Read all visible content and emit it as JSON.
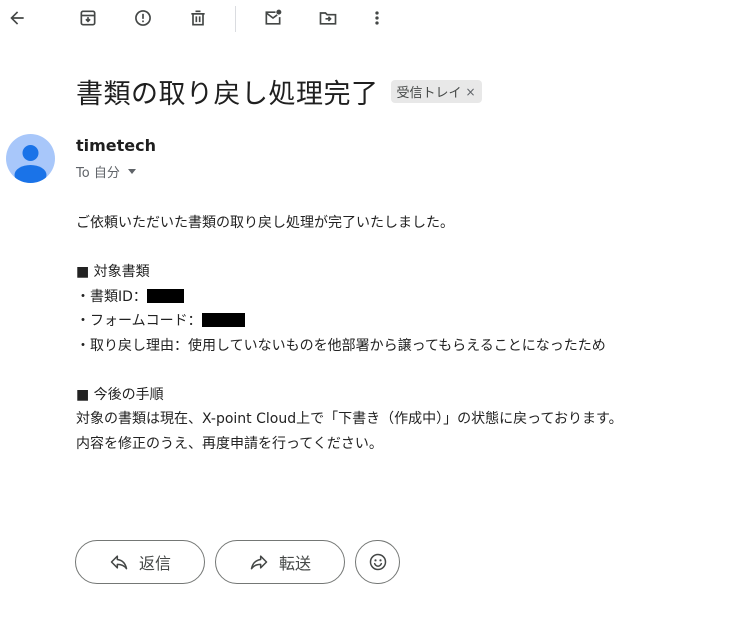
{
  "toolbar": {
    "items": [
      {
        "name": "back-icon"
      },
      {
        "name": "archive-icon"
      },
      {
        "name": "report-spam-icon"
      },
      {
        "name": "delete-icon"
      },
      {
        "name": "mark-unread-icon"
      },
      {
        "name": "move-to-icon"
      },
      {
        "name": "more-options-icon"
      }
    ]
  },
  "message": {
    "subject": "書類の取り戻し処理完了",
    "label": "受信トレイ",
    "label_remove": "×",
    "sender": "timetech",
    "recipient": "To 自分",
    "body": {
      "intro": "ご依頼いただいた書類の取り戻し処理が完了いたしました。",
      "section1_heading": "■ 対象書類",
      "doc_id_label": "・書類ID：",
      "form_code_label": "・フォームコード：",
      "reason": "・取り戻し理由：使用していないものを他部署から譲ってもらえることになったため",
      "section2_heading": "■ 今後の手順",
      "step_line1": "対象の書類は現在、X-point Cloud上で「下書き（作成中）」の状態に戻っております。",
      "step_line2": "内容を修正のうえ、再度申請を行ってください。"
    }
  },
  "actions": {
    "reply_label": "返信",
    "forward_label": "転送"
  },
  "colors": {
    "avatar_bg": "#a8c7fa",
    "avatar_fg": "#1a73e8",
    "chip_bg": "#e8e8e8"
  }
}
